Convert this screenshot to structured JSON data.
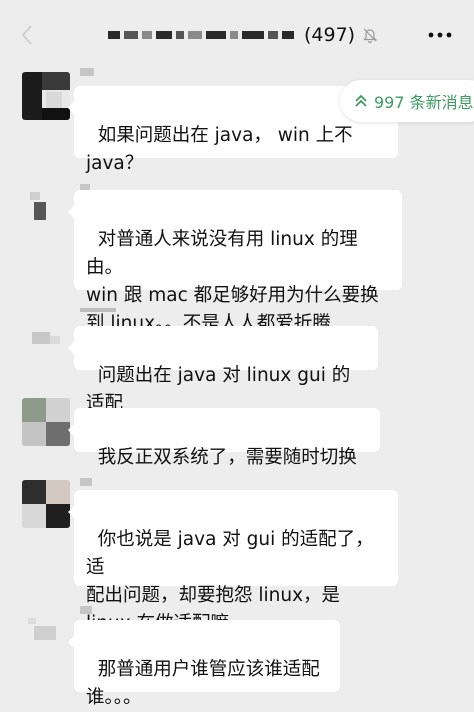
{
  "header": {
    "member_count": "(497)",
    "icons": {
      "back": "chevron-left-icon",
      "mute": "bell-off-icon",
      "more": "more-dots-icon"
    }
  },
  "new_messages": {
    "label": "997 条新消息",
    "icon": "double-chevron-up-icon",
    "color": "#3d9b5f"
  },
  "messages": [
    {
      "text": "如果问题出在 java， win 上不\njava？"
    },
    {
      "text": "对普通人来说没有用 linux 的理由。\nwin 跟 mac 都足够好用为什么要换\n到 linux。。不是人人都爱折腾"
    },
    {
      "sender_text": "J...",
      "text": "问题出在 java 对 linux gui 的适配"
    },
    {
      "text": "我反正双系统了，需要随时切换"
    },
    {
      "text": "你也说是 java 对 gui 的适配了，适\n配出问题，却要抱怨 linux，是\nlinux 在做适配嘛"
    },
    {
      "text": "那普通用户谁管应该谁适配\n谁。。。"
    }
  ],
  "colors": {
    "background": "#ededed",
    "bubble": "#ffffff",
    "accent": "#3d9b5f"
  }
}
